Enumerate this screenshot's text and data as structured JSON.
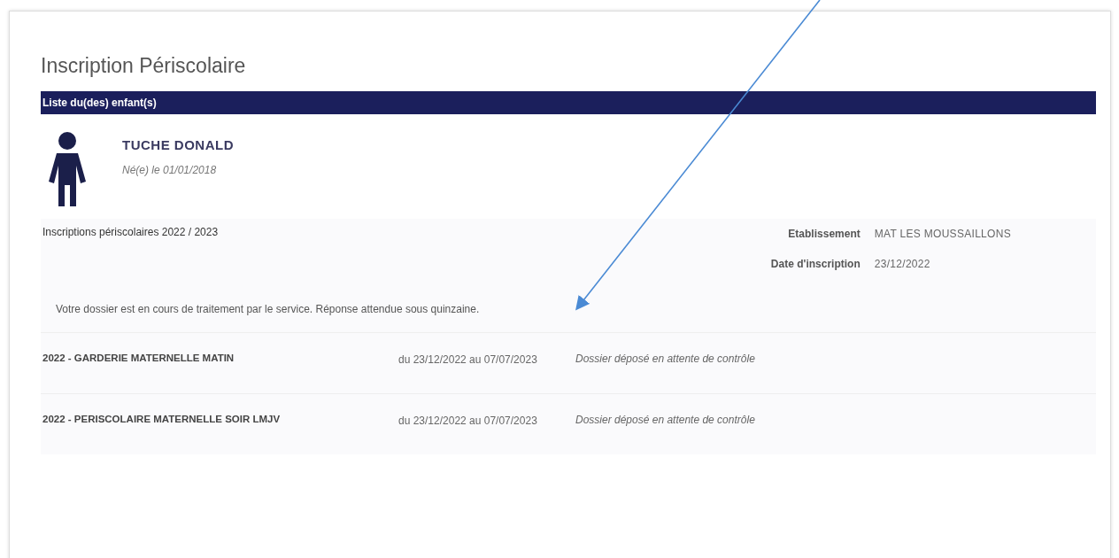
{
  "page": {
    "title": "Inscription Périscolaire"
  },
  "section_bar": {
    "label": "Liste du(des) enfant(s)"
  },
  "child": {
    "name": "TUCHE DONALD",
    "birth": "Né(e) le 01/01/2018"
  },
  "registrations": {
    "heading": "Inscriptions périscolaires 2022 / 2023",
    "details": [
      {
        "label": "Etablissement",
        "value": "MAT LES MOUSSAILLONS"
      },
      {
        "label": "Date d'inscription",
        "value": "23/12/2022"
      }
    ],
    "message": "Votre dossier est en cours de traitement par le service. Réponse attendue sous quinzaine.",
    "rows": [
      {
        "activity": "2022 - GARDERIE MATERNELLE MATIN",
        "period": "du 23/12/2022 au 07/07/2023",
        "status": "Dossier déposé en attente de contrôle"
      },
      {
        "activity": "2022 - PERISCOLAIRE MATERNELLE SOIR LMJV",
        "period": "du 23/12/2022 au 07/07/2023",
        "status": "Dossier déposé en attente de contrôle"
      }
    ]
  },
  "annotation": {
    "kind": "arrow"
  }
}
